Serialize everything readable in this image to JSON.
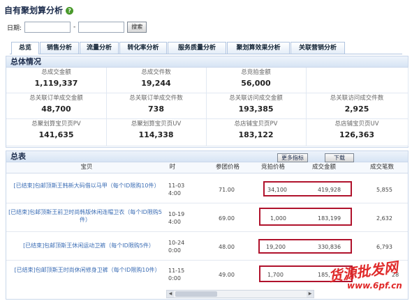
{
  "header": {
    "title": "自有聚划算分析"
  },
  "date_filter": {
    "label": "日期:",
    "separator": "-",
    "start": "",
    "end": "",
    "search_label": "搜索"
  },
  "tabs": [
    {
      "label": "总览"
    },
    {
      "label": "销售分析"
    },
    {
      "label": "流量分析"
    },
    {
      "label": "转化率分析"
    },
    {
      "label": "服务质量分析"
    },
    {
      "label": "聚划算效果分析"
    },
    {
      "label": "关联营销分析"
    }
  ],
  "overview": {
    "title": "总体情况",
    "row1": [
      {
        "label": "总成交金额",
        "value": "1,119,337"
      },
      {
        "label": "总成交件数",
        "value": "19,244"
      },
      {
        "label": "总竞拍金额",
        "value": "56,000"
      }
    ],
    "row2": [
      {
        "label": "总关联订单成交金额",
        "value": "48,700"
      },
      {
        "label": "总关联订单成交件数",
        "value": "738"
      },
      {
        "label": "总关联访问成交金额",
        "value": "193,385"
      },
      {
        "label": "总关联访问成交件数",
        "value": "2,925"
      }
    ],
    "row3": [
      {
        "label": "总聚划算宝贝页PV",
        "value": "141,635"
      },
      {
        "label": "总聚划算宝贝页UV",
        "value": "114,338"
      },
      {
        "label": "总店铺宝贝页PV",
        "value": "183,122"
      },
      {
        "label": "总店铺宝贝页UV",
        "value": "126,363"
      }
    ]
  },
  "table": {
    "title": "总表",
    "more_label": "更多指标",
    "download_label": "下载",
    "columns": [
      "宝贝",
      "时间",
      "参团价格",
      "竞拍价格",
      "成交金额",
      "成交笔数"
    ],
    "rows": [
      {
        "item": "[已结束]包邮顶斯王韩新大码借以马甲（每个ID限购10件）",
        "time1": "11-03",
        "time2": "4:00",
        "price": "71.00",
        "bid": "34,100",
        "amount": "419,928",
        "count": "5,855"
      },
      {
        "item": "[已结束]包邮顶斯王前卫时尚韩版休闲连帽卫衣（每个ID限购5件）",
        "time1": "10-19",
        "time2": "4:00",
        "price": "69.00",
        "bid": "1,000",
        "amount": "183,199",
        "count": "2,632"
      },
      {
        "item": "[已结束]包邮顶斯王休闲运动卫裤（每个ID限购5件）",
        "time1": "10-24",
        "time2": "0:00",
        "price": "48.00",
        "bid": "19,200",
        "amount": "330,836",
        "count": "6,793"
      },
      {
        "item": "[已结束]包邮顶斯王时尚休闲修身卫裤（每个ID限购10件）",
        "time1": "11-15",
        "time2": "0:00",
        "price": "49.00",
        "bid": "1,700",
        "amount": "185,",
        "count": "28"
      }
    ]
  },
  "watermark": {
    "line1": "货源批发网",
    "line2": "www.6pf.cn"
  },
  "colors": {
    "highlight_box": "#b0122c",
    "link": "#3a6cb4",
    "tab_border": "#b0c4e0"
  }
}
